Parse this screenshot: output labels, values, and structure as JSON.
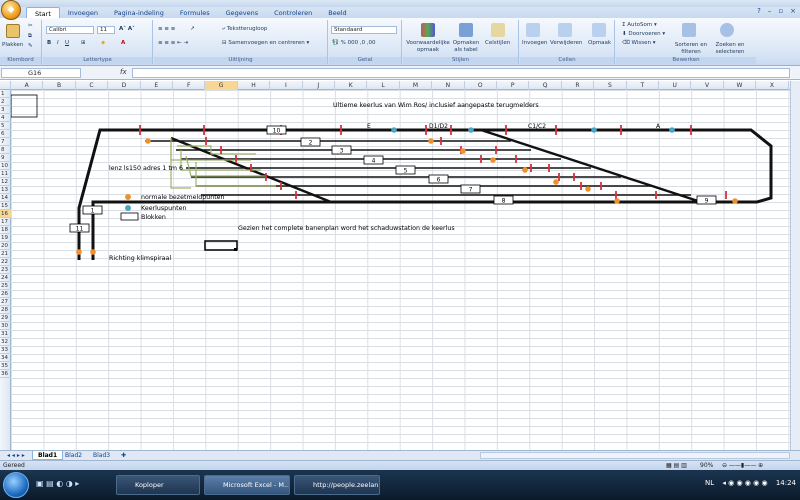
{
  "ribbon": {
    "tabs": [
      "Start",
      "Invoegen",
      "Pagina-indeling",
      "Formules",
      "Gegevens",
      "Controleren",
      "Beeld"
    ],
    "groups": {
      "klembord": {
        "label": "Klembord",
        "paste": "Plakken"
      },
      "lettertype": {
        "label": "Lettertype",
        "font": "Calibri",
        "size": "11"
      },
      "uitlijning": {
        "label": "Uitlijning",
        "wrap": "Tekstterugloop",
        "merge": "Samenvoegen en centreren"
      },
      "getal": {
        "label": "Getal",
        "format": "Standaard"
      },
      "stijlen": {
        "label": "Stijlen",
        "cond": "Voorwaardelijke opmaak",
        "table": "Opmaken als tabel",
        "cell": "Celstijlen"
      },
      "cellen": {
        "label": "Cellen",
        "insert": "Invoegen",
        "delete": "Verwijderen",
        "format": "Opmaak"
      },
      "bewerken": {
        "label": "Bewerken",
        "autosum": "AutoSom",
        "fill": "Doorvoeren",
        "clear": "Wissen",
        "sort": "Sorteren en filteren",
        "find": "Zoeken en selecteren"
      }
    }
  },
  "formula_bar": {
    "name_box": "G16",
    "fx": "fx"
  },
  "columns": [
    "A",
    "B",
    "C",
    "D",
    "E",
    "F",
    "G",
    "H",
    "I",
    "J",
    "K",
    "L",
    "M",
    "N",
    "O",
    "P",
    "Q",
    "R",
    "S",
    "T",
    "U",
    "V",
    "W",
    "X"
  ],
  "rows": [
    "1",
    "2",
    "3",
    "4",
    "5",
    "6",
    "7",
    "8",
    "9",
    "10",
    "11",
    "12",
    "13",
    "14",
    "15",
    "16",
    "17",
    "18",
    "19",
    "20",
    "21",
    "22",
    "23",
    "24",
    "25",
    "26",
    "27",
    "28",
    "29",
    "30",
    "31",
    "32",
    "33",
    "34",
    "35",
    "36"
  ],
  "diagram": {
    "title": "Ultieme keerlus van Wim Ros/ inclusief aangepaste terugmelders",
    "station_labels": [
      "E",
      "D1/D2",
      "C1/C2",
      "A"
    ],
    "blocks": [
      "10",
      "2",
      "3",
      "4",
      "5",
      "6",
      "7",
      "8",
      "9",
      "1",
      "11"
    ],
    "lenz_note": "lenz ls150 adres 1 tm 6",
    "legend_orange": "normale bezetmeldpunten",
    "legend_blue": "Keerluspunten",
    "legend_box": "Blokken",
    "caption": "Gezien het complete banenplan word het schaduwstation de keerlus",
    "direction": "Richting klimspiraal",
    "colors": {
      "orange": "#f0922b",
      "blue": "#4aa6c8",
      "red": "#d9303a",
      "olive": "#9fb26a"
    }
  },
  "sheets": [
    "Blad1",
    "Blad2",
    "Blad3"
  ],
  "status": {
    "ready": "Gereed",
    "zoom": "90%"
  },
  "taskbar": {
    "items": [
      "Koploper",
      "Microsoft Excel - M...",
      "http://people.zeelan..."
    ],
    "lang": "NL",
    "time": "14:24"
  }
}
